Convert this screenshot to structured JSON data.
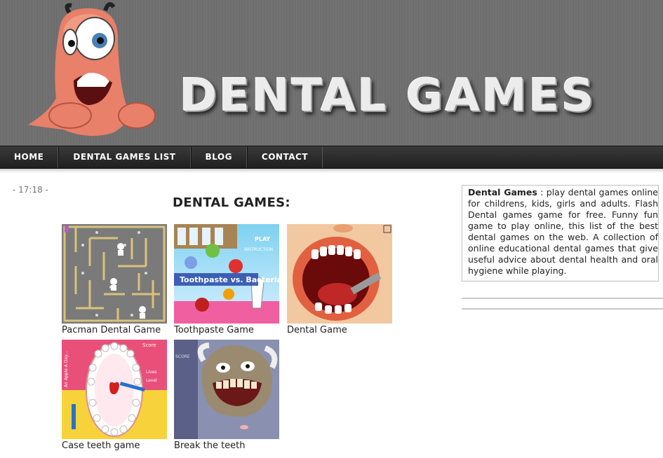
{
  "header": {
    "site_title": "DENTAL GAMES"
  },
  "nav": {
    "items": [
      {
        "label": "HOME"
      },
      {
        "label": "DENTAL GAMES LIST"
      },
      {
        "label": "BLOG"
      },
      {
        "label": "CONTACT"
      }
    ]
  },
  "main": {
    "clock": "- 17:18 -",
    "section_title": "DENTAL GAMES:",
    "games": [
      {
        "label": "Pacman Dental Game"
      },
      {
        "label": "Toothpaste Game"
      },
      {
        "label": "Dental Game"
      },
      {
        "label": "Case teeth game"
      },
      {
        "label": "Break the teeth"
      }
    ],
    "thumb_text": {
      "toothpaste_title": "Toothpaste vs. Bacteria",
      "play": "PLAY",
      "instruction": "INSTRUCTION",
      "score": "Score",
      "lives": "Lives",
      "level": "Level",
      "apple": "An Apple A Day...",
      "score_caps": "SCORE"
    }
  },
  "sidebar": {
    "desc_bold": "Dental Games",
    "desc_text": " : play dental games online for childrens, kids, girls and adults. Flash Dental games game for free. Funny fun game to play online, this list of the best dental games on the web. A collection of online educational dental games that give useful advice about dental health and oral hygiene while playing."
  },
  "colors": {
    "banner_bg": "#6e6e6e",
    "nav_bg": "#262626",
    "text": "#222222"
  }
}
